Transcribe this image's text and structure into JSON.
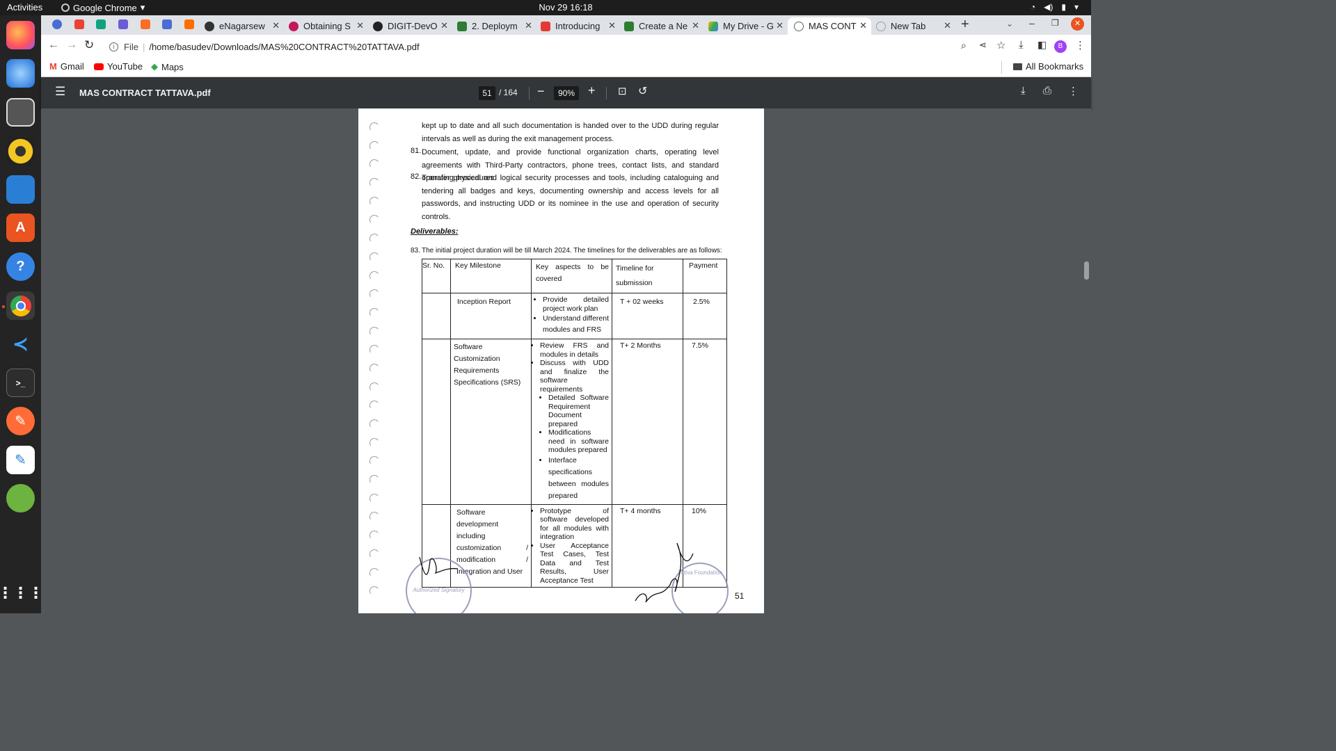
{
  "os": {
    "activities": "Activities",
    "app_name": "Google Chrome",
    "clock": "Nov 29  16:18"
  },
  "tabs": [
    {
      "label": "eNagarsew",
      "color": "#333"
    },
    {
      "label": "Obtaining S",
      "color": "#c2185b"
    },
    {
      "label": "DIGIT-DevO",
      "color": "#222"
    },
    {
      "label": "2. Deploym",
      "color": "#2e7d32"
    },
    {
      "label": "Introducing",
      "color": "#e53935"
    },
    {
      "label": "Create a Ne",
      "color": "#2e7d32"
    },
    {
      "label": "My Drive - G",
      "color": "#fbbc04"
    },
    {
      "label": "MAS CONT",
      "color": "#5f6368"
    },
    {
      "label": "New Tab",
      "color": "#9aa0a6"
    }
  ],
  "address": {
    "scheme": "File",
    "url": "/home/basudev/Downloads/MAS%20CONTRACT%20TATTAVA.pdf"
  },
  "profile_initial": "B",
  "bookmarks": {
    "gmail": "Gmail",
    "youtube": "YouTube",
    "maps": "Maps",
    "all": "All Bookmarks"
  },
  "pdf": {
    "title": "MAS CONTRACT TATTAVA.pdf",
    "page_current": "51",
    "page_total": "/ 164",
    "zoom": "90%"
  },
  "doc": {
    "p_cont": "kept up to date and all such documentation is handed over to the UDD  during regular intervals as well as during the exit management process.",
    "n81": "81.",
    "p81": "Document, update, and provide functional organization charts, operating level agreements with Third-Party contractors, phone trees, contact lists, and standard operating procedures",
    "n82": "82.",
    "p82": "Transfer physical and logical security processes and tools, including cataloguing and tendering all badges and keys, documenting ownership and access levels for all passwords, and instructing UDD or its nominee in the use and operation of security controls.",
    "deliverables": "Deliverables:",
    "n83": "83.",
    "p83": "The initial project duration will be till March 2024. The timelines for the deliverables are as follows:",
    "table_headers": [
      "Sr. No.",
      "Key Milestone",
      "Key aspects to be covered",
      "Timeline for submission",
      "Payment"
    ],
    "rows": [
      {
        "milestone": "Inception Report",
        "aspects": [
          "Provide detailed project work plan",
          "Understand different modules and FRS"
        ],
        "timeline": "T +  02 weeks",
        "payment": "2.5%"
      },
      {
        "milestone": "Software Customization Requirements Specifications (SRS)",
        "aspects": [
          "Review FRS and modules in details",
          "Discuss with UDD and finalize the software requirements",
          "Detailed Software Requirement Document prepared",
          "Modifications need in software modules prepared",
          "Interface specifications between modules prepared"
        ],
        "timeline": "T+ 2 Months",
        "payment": "7.5%"
      },
      {
        "milestone": "Software development including customization / modification / Integration and User",
        "aspects": [
          "Prototype of software developed for all modules with integration",
          "User Acceptance Test Cases, Test Data and Test Results, User Acceptance Test"
        ],
        "timeline": "T+ 4 months",
        "payment": "10%"
      }
    ],
    "page_number": "51",
    "stamp_left": "Authorized Signatory",
    "stamp_right": "Tattva Foundation"
  }
}
